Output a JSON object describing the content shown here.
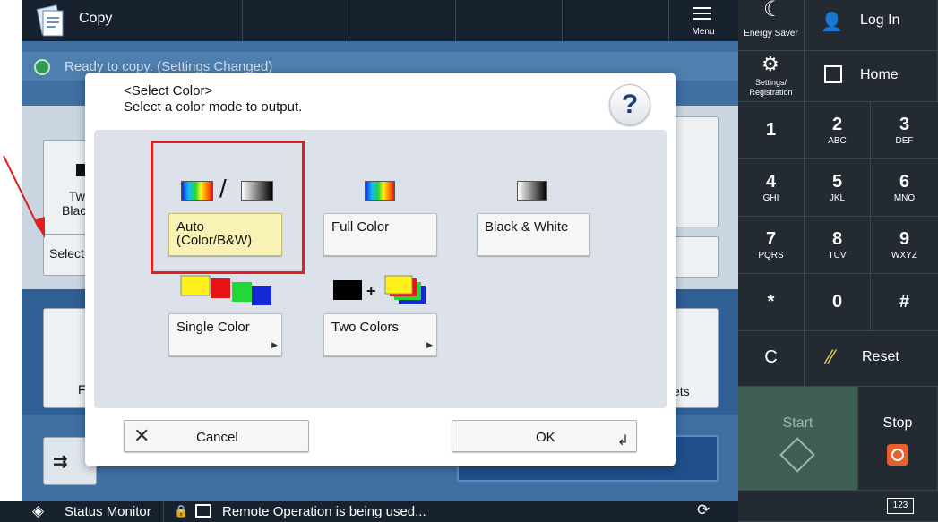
{
  "header": {
    "app_title": "Copy",
    "menu_label": "Menu"
  },
  "status": {
    "message": "Ready to copy. (Settings Changed)"
  },
  "background": {
    "two_sided_label_1": "Tw",
    "two_sided_label_2": "Blac",
    "select_label": "Select",
    "lower_left_label": "F",
    "lower_right_label": "ets"
  },
  "keypad": {
    "energy_saver": "Energy Saver",
    "login": "Log In",
    "settings": "Settings/\nRegistration",
    "home": "Home",
    "keys": [
      {
        "num": "1",
        "sub": ""
      },
      {
        "num": "2",
        "sub": "ABC"
      },
      {
        "num": "3",
        "sub": "DEF"
      },
      {
        "num": "4",
        "sub": "GHI"
      },
      {
        "num": "5",
        "sub": "JKL"
      },
      {
        "num": "6",
        "sub": "MNO"
      },
      {
        "num": "7",
        "sub": "PQRS"
      },
      {
        "num": "8",
        "sub": "TUV"
      },
      {
        "num": "9",
        "sub": "WXYZ"
      },
      {
        "num": "*",
        "sub": ""
      },
      {
        "num": "0",
        "sub": ""
      },
      {
        "num": "#",
        "sub": ""
      }
    ],
    "clear": "C",
    "reset": "Reset",
    "start": "Start",
    "stop": "Stop",
    "keyboard_label": "123"
  },
  "bottom_bar": {
    "status_monitor": "Status Monitor",
    "remote_message": "Remote Operation is being used..."
  },
  "dialog": {
    "title": "<Select Color>",
    "subtitle": "Select a color mode to output.",
    "help_symbol": "?",
    "options": {
      "auto_line1": "Auto",
      "auto_line2": "(Color/B&W)",
      "full_color": "Full Color",
      "black_white": "Black & White",
      "single_color": "Single Color",
      "two_colors": "Two Colors"
    },
    "cancel": "Cancel",
    "ok": "OK"
  },
  "colors": {
    "highlight": "#e02020",
    "selected_option": "#f8f2b4",
    "screen_blue": "#3f6fa3",
    "topbar": "#18222e"
  }
}
